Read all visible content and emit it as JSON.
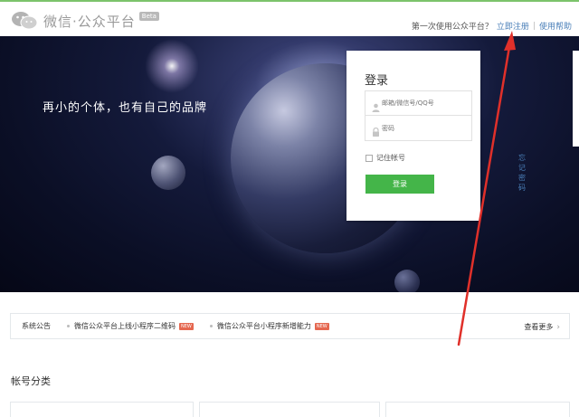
{
  "header": {
    "logo_text": "微信·公众平台",
    "beta_label": "Beta",
    "register_prompt": "第一次使用公众平台？",
    "register_link": "立即注册",
    "separator": "|",
    "help_link": "使用帮助"
  },
  "banner": {
    "slogan": "再小的个体，也有自己的品牌"
  },
  "login": {
    "title": "登录",
    "account_placeholder": "邮箱/微信号/QQ号",
    "password_placeholder": "密码",
    "remember_label": "记住帐号",
    "forgot_link": "忘记密码",
    "submit_label": "登录"
  },
  "notice": {
    "label": "系统公告",
    "items": [
      {
        "text": "微信公众平台上线小程序二维码",
        "badge": "NEW"
      },
      {
        "text": "微信公众平台小程序新增能力",
        "badge": "NEW"
      }
    ],
    "more_label": "查看更多",
    "more_chevron": "›"
  },
  "section": {
    "title": "帐号分类"
  },
  "colors": {
    "accent_green": "#44b549",
    "link_blue": "#4a7fb8",
    "annotation_red": "#e0302a"
  },
  "icons": {
    "logo": "wechat-logo-icon",
    "account": "user-icon",
    "password": "lock-icon",
    "more": "chevron-right-icon"
  }
}
